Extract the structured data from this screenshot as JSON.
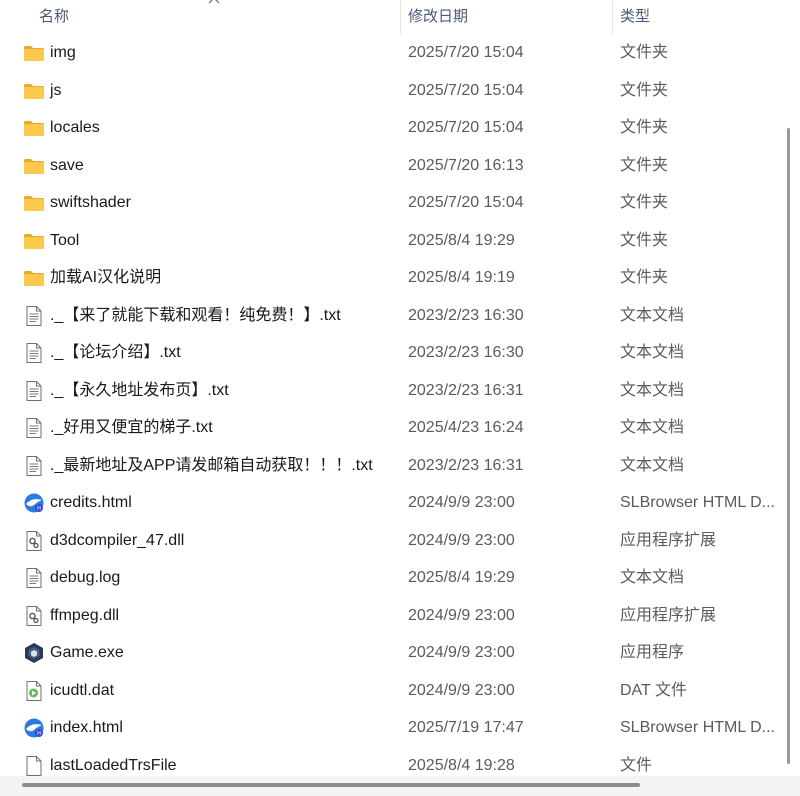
{
  "columns": {
    "name": "名称",
    "date": "修改日期",
    "type": "类型"
  },
  "files": [
    {
      "icon": "folder-icon",
      "name": "img",
      "date": "2025/7/20 15:04",
      "type": "文件夹"
    },
    {
      "icon": "folder-icon",
      "name": "js",
      "date": "2025/7/20 15:04",
      "type": "文件夹"
    },
    {
      "icon": "folder-icon",
      "name": "locales",
      "date": "2025/7/20 15:04",
      "type": "文件夹"
    },
    {
      "icon": "folder-icon",
      "name": "save",
      "date": "2025/7/20 16:13",
      "type": "文件夹"
    },
    {
      "icon": "folder-icon",
      "name": "swiftshader",
      "date": "2025/7/20 15:04",
      "type": "文件夹"
    },
    {
      "icon": "folder-icon",
      "name": "Tool",
      "date": "2025/8/4 19:29",
      "type": "文件夹"
    },
    {
      "icon": "folder-icon",
      "name": "加载AI汉化说明",
      "date": "2025/8/4 19:19",
      "type": "文件夹"
    },
    {
      "icon": "text-file-icon",
      "name": "._【来了就能下载和观看！纯免费！】.txt",
      "date": "2023/2/23 16:30",
      "type": "文本文档"
    },
    {
      "icon": "text-file-icon",
      "name": "._【论坛介绍】.txt",
      "date": "2023/2/23 16:30",
      "type": "文本文档"
    },
    {
      "icon": "text-file-icon",
      "name": "._【永久地址发布页】.txt",
      "date": "2023/2/23 16:31",
      "type": "文本文档"
    },
    {
      "icon": "text-file-icon",
      "name": "._好用又便宜的梯子.txt",
      "date": "2025/4/23 16:24",
      "type": "文本文档"
    },
    {
      "icon": "text-file-icon",
      "name": "._最新地址及APP请发邮箱自动获取！！！.txt",
      "date": "2023/2/23 16:31",
      "type": "文本文档"
    },
    {
      "icon": "browser-html-icon",
      "name": "credits.html",
      "date": "2024/9/9 23:00",
      "type": "SLBrowser HTML D..."
    },
    {
      "icon": "dll-gear-icon",
      "name": "d3dcompiler_47.dll",
      "date": "2024/9/9 23:00",
      "type": "应用程序扩展"
    },
    {
      "icon": "text-file-icon",
      "name": "debug.log",
      "date": "2025/8/4 19:29",
      "type": "文本文档"
    },
    {
      "icon": "dll-gear-icon",
      "name": "ffmpeg.dll",
      "date": "2024/9/9 23:00",
      "type": "应用程序扩展"
    },
    {
      "icon": "game-exe-icon",
      "name": "Game.exe",
      "date": "2024/9/9 23:00",
      "type": "应用程序"
    },
    {
      "icon": "media-file-icon",
      "name": "icudtl.dat",
      "date": "2024/9/9 23:00",
      "type": "DAT 文件"
    },
    {
      "icon": "browser-html-icon",
      "name": "index.html",
      "date": "2025/7/19 17:47",
      "type": "SLBrowser HTML D..."
    },
    {
      "icon": "blank-file-icon",
      "name": "lastLoadedTrsFile",
      "date": "2025/8/4 19:28",
      "type": "文件"
    }
  ],
  "colors": {
    "folder": "#f6c445",
    "header_text": "#4a5a78",
    "secondary_text": "#5b5b5b",
    "scrollbar": "#8c8c8c"
  }
}
